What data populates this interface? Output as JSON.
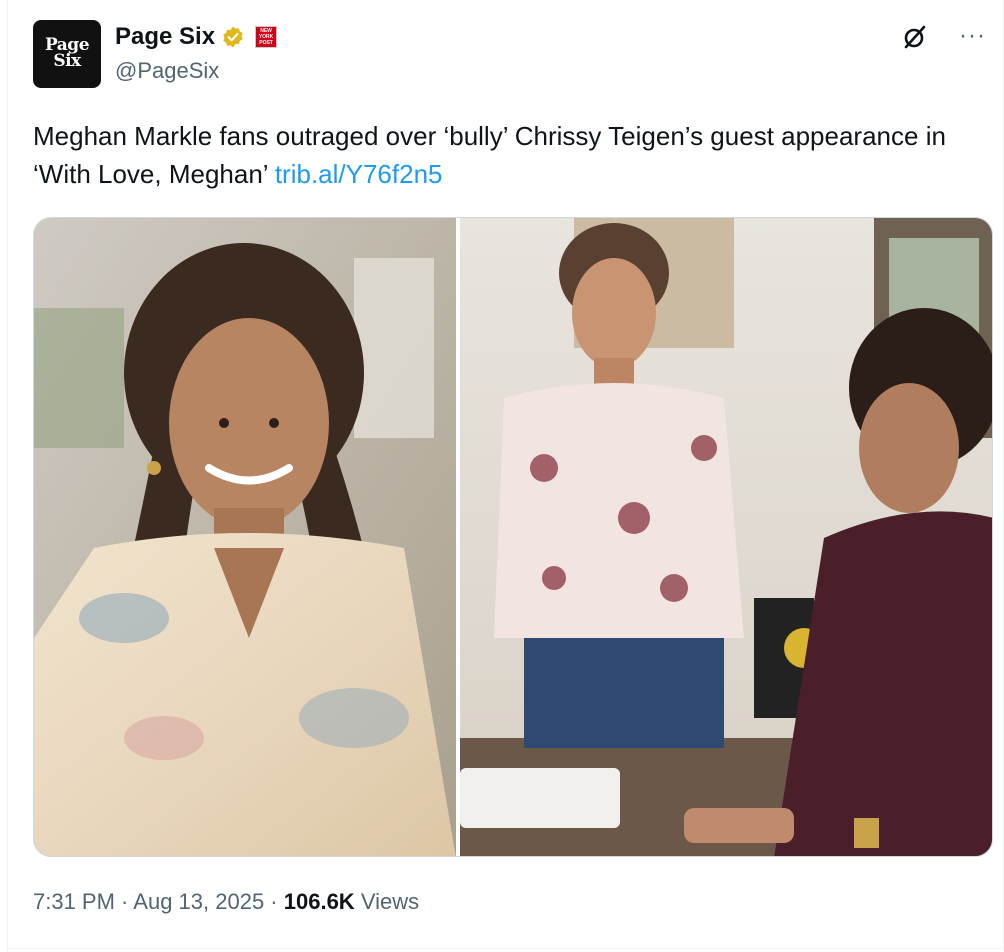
{
  "author": {
    "avatar_text_line1": "Page",
    "avatar_text_line2": "Six",
    "display_name": "Page Six",
    "handle": "@PageSix",
    "affiliate_badge": "NEW YORK POST"
  },
  "header_actions": {
    "grok_icon": "grok-icon",
    "more_label": "···"
  },
  "tweet": {
    "text": "Meghan Markle fans outraged over ‘bully’ Chrissy Teigen’s guest appearance in ‘With Love, Meghan’ ",
    "link": "trib.al/Y76f2n5"
  },
  "meta": {
    "time": "7:31 PM",
    "sep1": " · ",
    "date": "Aug 13, 2025",
    "sep2": " · ",
    "views_count": "106.6K",
    "views_label": " Views"
  },
  "colors": {
    "link": "#1d9bf0",
    "secondary_text": "#536471",
    "verified_gold": "#e2b719"
  }
}
